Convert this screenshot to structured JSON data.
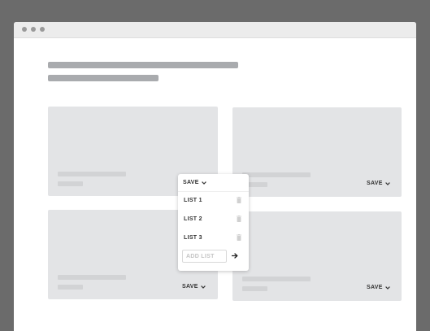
{
  "window": {
    "controls": [
      "close-dot",
      "minimize-dot",
      "maximize-dot"
    ]
  },
  "cards": [
    {
      "save_label": "SAVE"
    },
    {
      "save_label": "SAVE"
    },
    {
      "save_label": "SAVE"
    },
    {
      "save_label": "SAVE"
    }
  ],
  "save_menu": {
    "save_label": "SAVE",
    "lists": [
      {
        "label": "LIST 1"
      },
      {
        "label": "LIST 2"
      },
      {
        "label": "LIST 3"
      }
    ],
    "add_placeholder": "ADD LIST",
    "add_value": ""
  }
}
